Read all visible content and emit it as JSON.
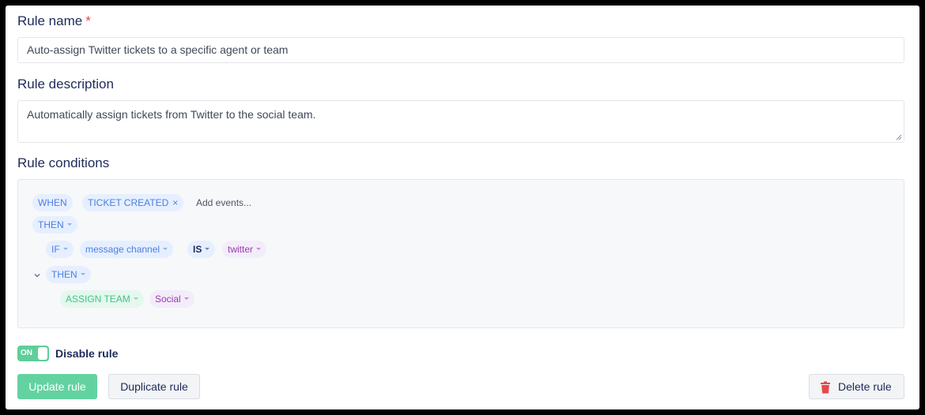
{
  "rule_name": {
    "label": "Rule name",
    "required_marker": "*",
    "value": "Auto-assign Twitter tickets to a specific agent or team"
  },
  "rule_description": {
    "label": "Rule description",
    "value": "Automatically assign tickets from Twitter to the social team."
  },
  "rule_conditions": {
    "label": "Rule conditions",
    "when_label": "WHEN",
    "event_chip": "TICKET CREATED",
    "event_remove": "×",
    "add_events_placeholder": "Add events...",
    "then_label": "THEN",
    "if_label": "IF",
    "field_label": "message channel",
    "operator_label": "IS",
    "value_label": "twitter",
    "nested_then_label": "THEN",
    "action_label": "ASSIGN TEAM",
    "action_value": "Social"
  },
  "toggle": {
    "state_text": "ON",
    "label": "Disable rule"
  },
  "buttons": {
    "update": "Update rule",
    "duplicate": "Duplicate rule",
    "delete": "Delete rule"
  },
  "icons": {
    "trash": "trash-icon",
    "collapse": "chevron-down-icon",
    "caret": "caret-down-icon",
    "remove": "close-icon"
  },
  "colors": {
    "primary_green": "#63d2a1",
    "label_navy": "#1e2a5a",
    "chip_blue": "#4a7fe0",
    "chip_purple": "#9a3bb0",
    "chip_green": "#3cc585",
    "danger_red": "#e5484d"
  }
}
